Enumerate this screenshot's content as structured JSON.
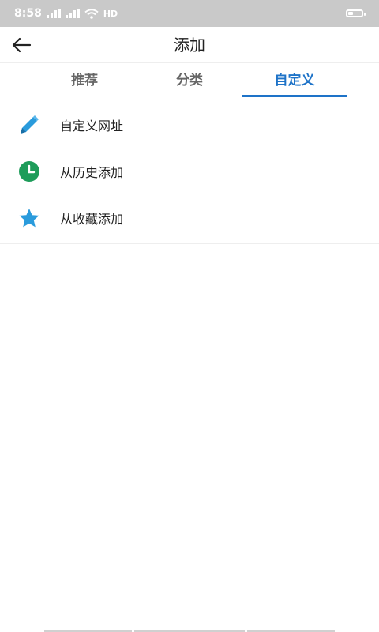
{
  "status_bar": {
    "time": "8:58",
    "network": "HD",
    "battery_level": 0.4
  },
  "header": {
    "title": "添加",
    "back_icon": "arrow-left-icon"
  },
  "tabs": [
    {
      "label": "推荐",
      "active": false
    },
    {
      "label": "分类",
      "active": false
    },
    {
      "label": "自定义",
      "active": true
    }
  ],
  "list": [
    {
      "label": "自定义网址",
      "icon": "pencil-icon",
      "icon_color": "#2a9bdc"
    },
    {
      "label": "从历史添加",
      "icon": "clock-icon",
      "icon_color": "#1e9c5a"
    },
    {
      "label": "从收藏添加",
      "icon": "star-icon",
      "icon_color": "#2a9bdc"
    }
  ],
  "colors": {
    "accent": "#1e73c8",
    "status_bar": "#c9c9c9"
  }
}
